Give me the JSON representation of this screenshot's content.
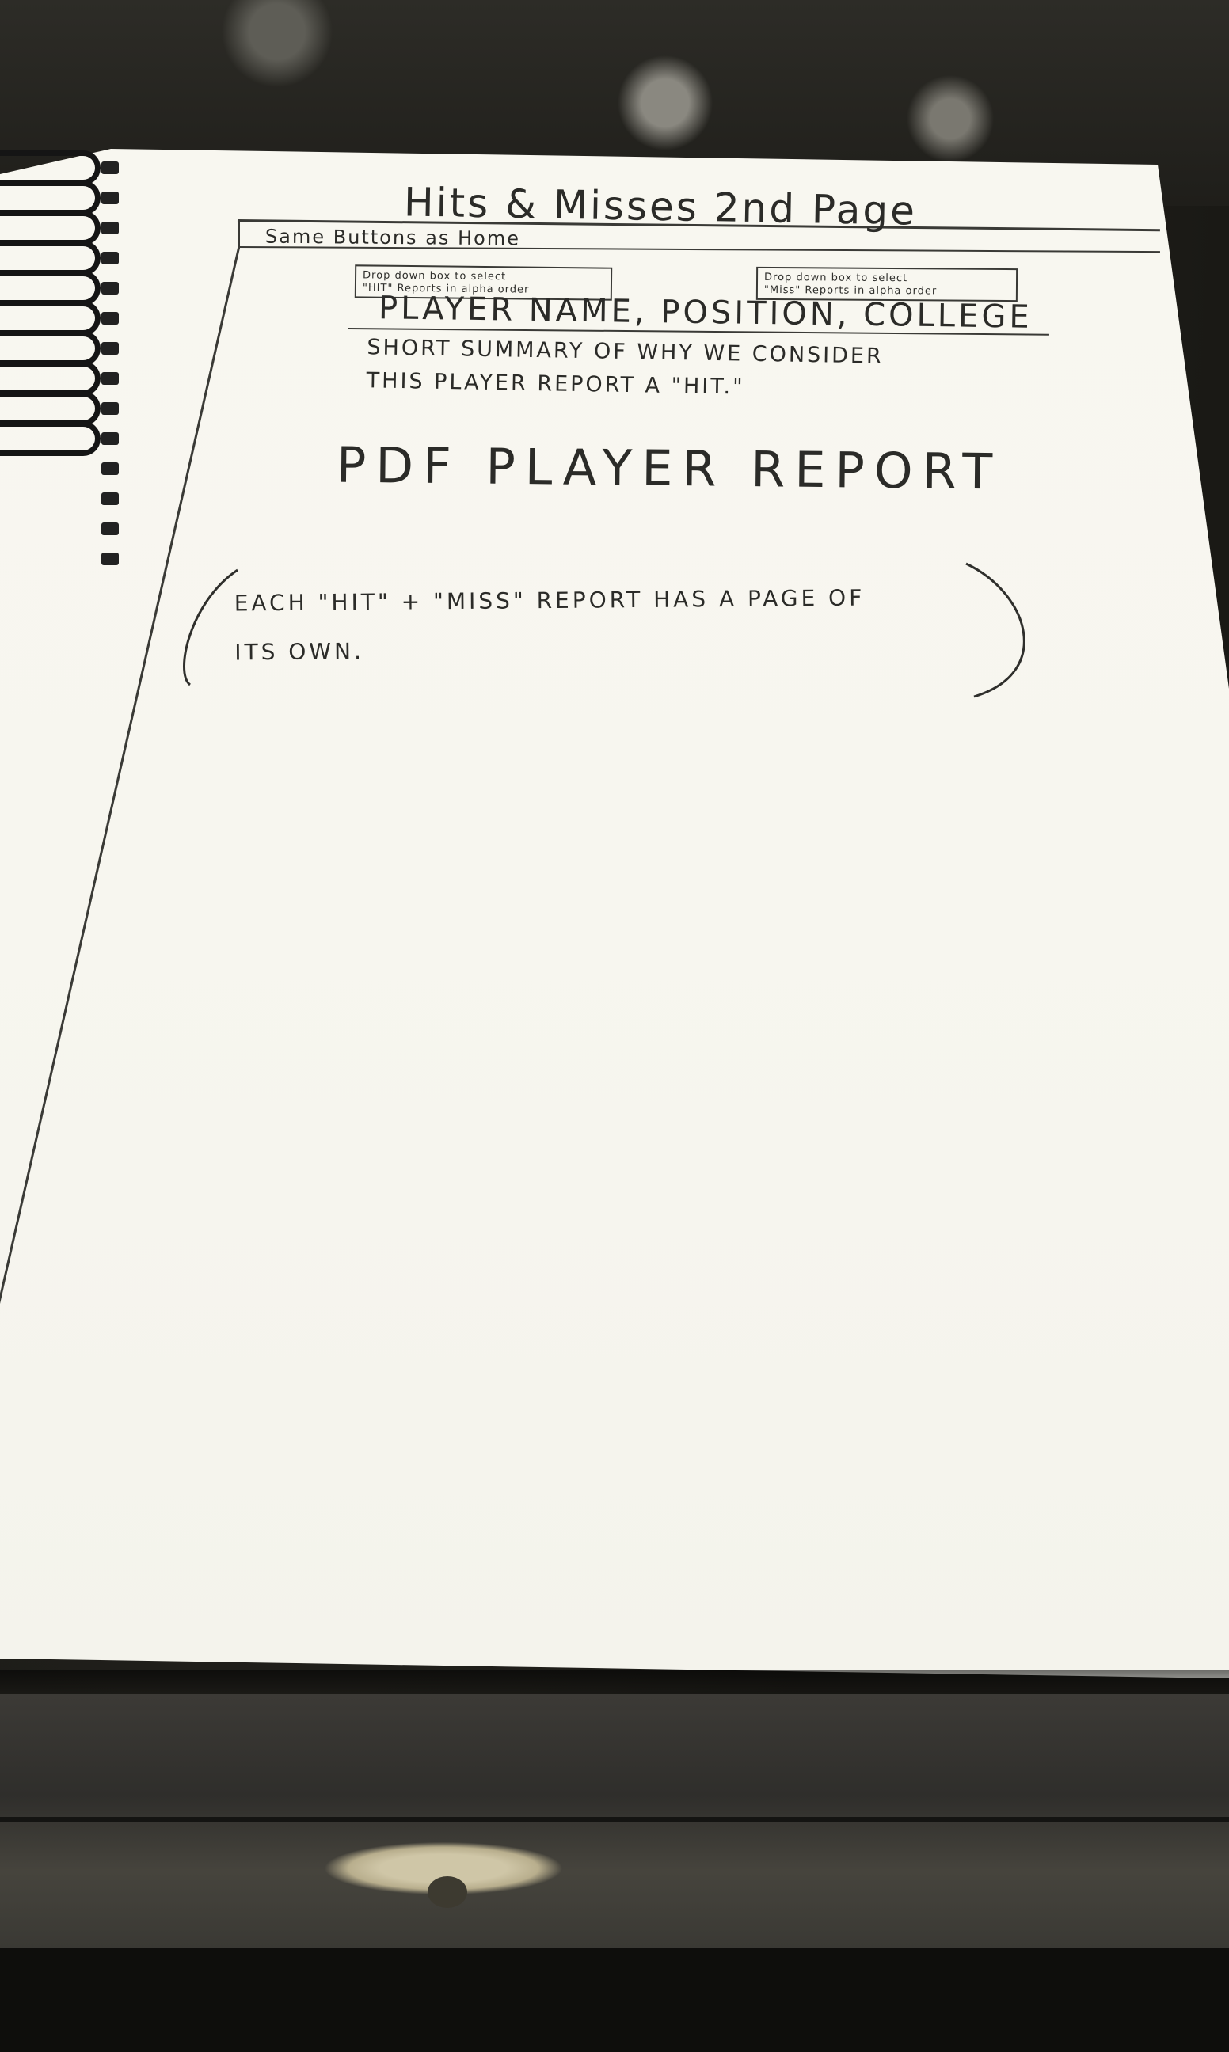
{
  "sketch": {
    "title": "Hits & Misses   2nd Page",
    "subtitle": "Same Buttons as Home",
    "dropdown_hits": "Drop down box to select\n\"HIT\" Reports in alpha order",
    "dropdown_misses": "Drop down box to select\n\"Miss\" Reports in alpha order",
    "player_heading": "PLAYER NAME, POSITION, COLLEGE",
    "summary_line1": "SHORT SUMMARY OF WHY WE CONSIDER",
    "summary_line2": "THIS PLAYER REPORT A \"HIT.\"",
    "pdf_label": "PDF PLAYER REPORT",
    "note_line1": "EACH \"HIT\" + \"MISS\" REPORT HAS A PAGE OF",
    "note_line2": "ITS OWN."
  }
}
